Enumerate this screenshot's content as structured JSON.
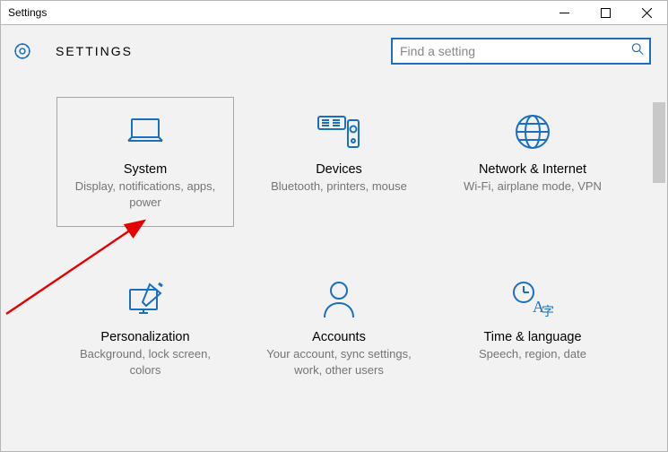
{
  "window": {
    "title": "Settings"
  },
  "header": {
    "app_title": "SETTINGS"
  },
  "search": {
    "placeholder": "Find a setting"
  },
  "tiles": {
    "system": {
      "title": "System",
      "desc": "Display, notifications, apps, power"
    },
    "devices": {
      "title": "Devices",
      "desc": "Bluetooth, printers, mouse"
    },
    "network": {
      "title": "Network & Internet",
      "desc": "Wi-Fi, airplane mode, VPN"
    },
    "personalize": {
      "title": "Personalization",
      "desc": "Background, lock screen, colors"
    },
    "accounts": {
      "title": "Accounts",
      "desc": "Your account, sync settings, work, other users"
    },
    "time": {
      "title": "Time & language",
      "desc": "Speech, region, date"
    }
  },
  "colors": {
    "accent": "#1b6fc1"
  }
}
